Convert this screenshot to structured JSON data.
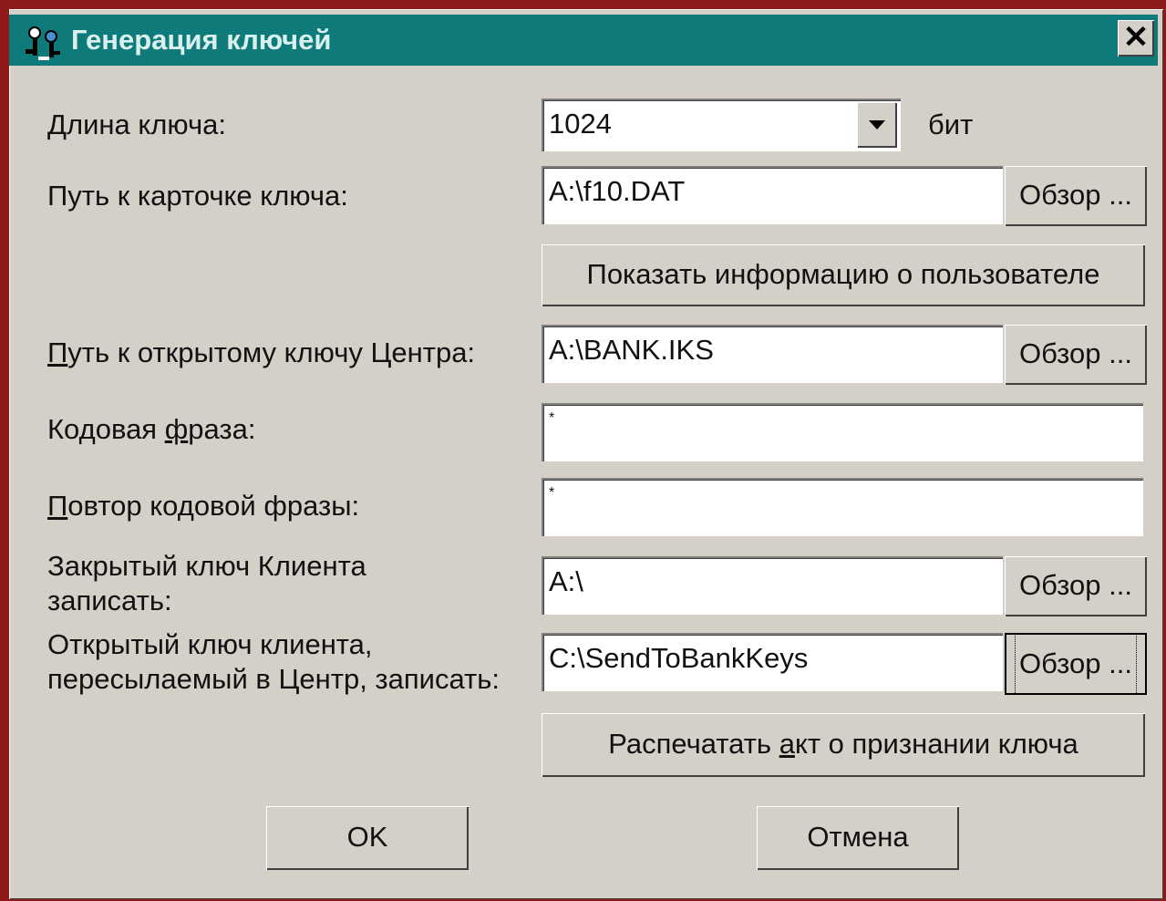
{
  "window": {
    "title": "Генерация ключей",
    "close_label": "✕"
  },
  "form": {
    "key_length": {
      "label": "Длина ключа:",
      "value": "1024",
      "unit": "бит"
    },
    "key_card_path": {
      "label": "Путь к карточке ключа:",
      "value": "A:\\f10.DAT",
      "browse_label": "Обзор ..."
    },
    "show_user_info_label": "Показать информацию о пользователе",
    "center_public_key_path": {
      "label_underlined": "П",
      "label_rest": "уть к открытому ключу Центра:",
      "value": "A:\\BANK.IKS",
      "browse_label": "Обзор ..."
    },
    "passphrase": {
      "label_pre": "Кодовая ",
      "label_underlined": "ф",
      "label_rest": "раза:",
      "value": "*"
    },
    "passphrase_repeat": {
      "label_underlined": "П",
      "label_rest": "овтор кодовой фразы:",
      "value": "*"
    },
    "client_private_key": {
      "label_line1": "Закрытый ключ Клиента",
      "label_line2": "записать:",
      "value": "A:\\",
      "browse_label": "Обзор ..."
    },
    "client_public_key": {
      "label_line1": "Открытый ключ клиента,",
      "label_line2": "пересылаемый в Центр, записать:",
      "value": "C:\\SendToBankKeys",
      "browse_label": "Обзор ..."
    },
    "print_act": {
      "label_pre": "Распечатать ",
      "label_underlined": "а",
      "label_rest": "кт о признании ключа"
    }
  },
  "buttons": {
    "ok_label": "OK",
    "cancel_label": "Отмена"
  }
}
